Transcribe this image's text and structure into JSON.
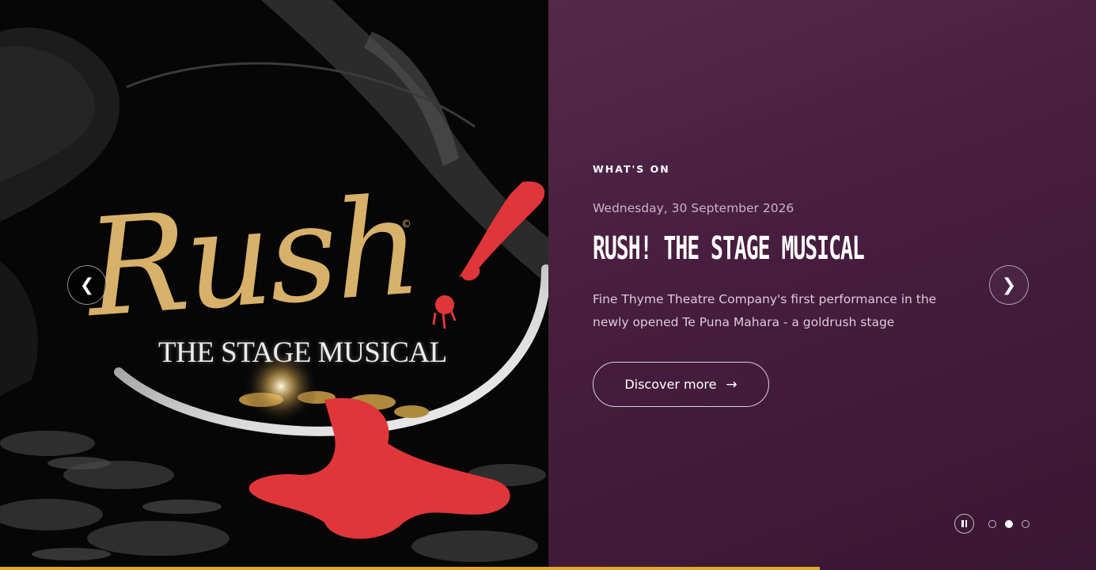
{
  "poster": {
    "title": "Rush",
    "copyright": "©",
    "subtitle": "THE STAGE MUSICAL"
  },
  "slide": {
    "eyebrow": "WHAT'S ON",
    "date": "Wednesday, 30 September 2026",
    "title": "RUSH! THE STAGE MUSICAL",
    "description": "Fine Thyme Theatre Company's first performance in the newly opened Te Puna Mahara - a goldrush stage",
    "cta_label": "Discover more",
    "cta_arrow": "→"
  },
  "nav": {
    "prev_glyph": "❮",
    "next_glyph": "❯",
    "prev_icon": "chevron-left-icon",
    "next_icon": "chevron-right-icon"
  },
  "controls": {
    "pause_icon": "pause-icon",
    "slide_count": 3,
    "active_index": 1
  },
  "progress": {
    "fraction": 0.748
  },
  "colors": {
    "panel": "#461d3f",
    "accent": "#e5a72a",
    "poster_gold": "#d7b06a",
    "poster_red": "#e0363a"
  }
}
